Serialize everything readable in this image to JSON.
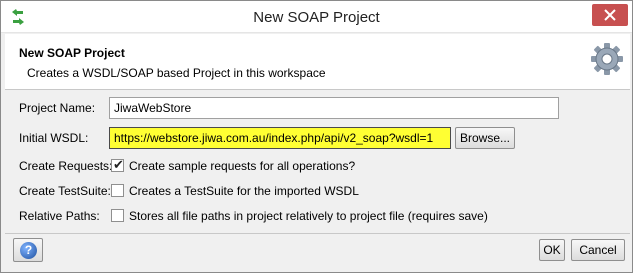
{
  "window": {
    "title": "New SOAP Project"
  },
  "header": {
    "title": "New SOAP Project",
    "subtitle": "Creates a WSDL/SOAP based Project in this workspace"
  },
  "form": {
    "project_name_label": "Project Name:",
    "project_name_value": "JiwaWebStore",
    "initial_wsdl_label": "Initial WSDL:",
    "initial_wsdl_value": "https://webstore.jiwa.com.au/index.php/api/v2_soap?wsdl=1",
    "browse_label": "Browse...",
    "create_requests_label": "Create Requests:",
    "create_requests_text": "Create sample requests for all operations?",
    "create_requests_checked": true,
    "create_testsuite_label": "Create TestSuite:",
    "create_testsuite_text": "Creates a TestSuite for the imported WSDL",
    "create_testsuite_checked": false,
    "relative_paths_label": "Relative Paths:",
    "relative_paths_text": "Stores all file paths in project relatively to project file (requires save)",
    "relative_paths_checked": false
  },
  "footer": {
    "help_symbol": "?",
    "ok_label": "OK",
    "cancel_label": "Cancel"
  },
  "colors": {
    "wsdl_highlight": "#ffff33",
    "close_button": "#c75050"
  },
  "icons": {
    "app": "soapui-icon",
    "close": "close-icon",
    "settings": "gear-icon",
    "help": "help-icon",
    "check": "check-icon"
  }
}
